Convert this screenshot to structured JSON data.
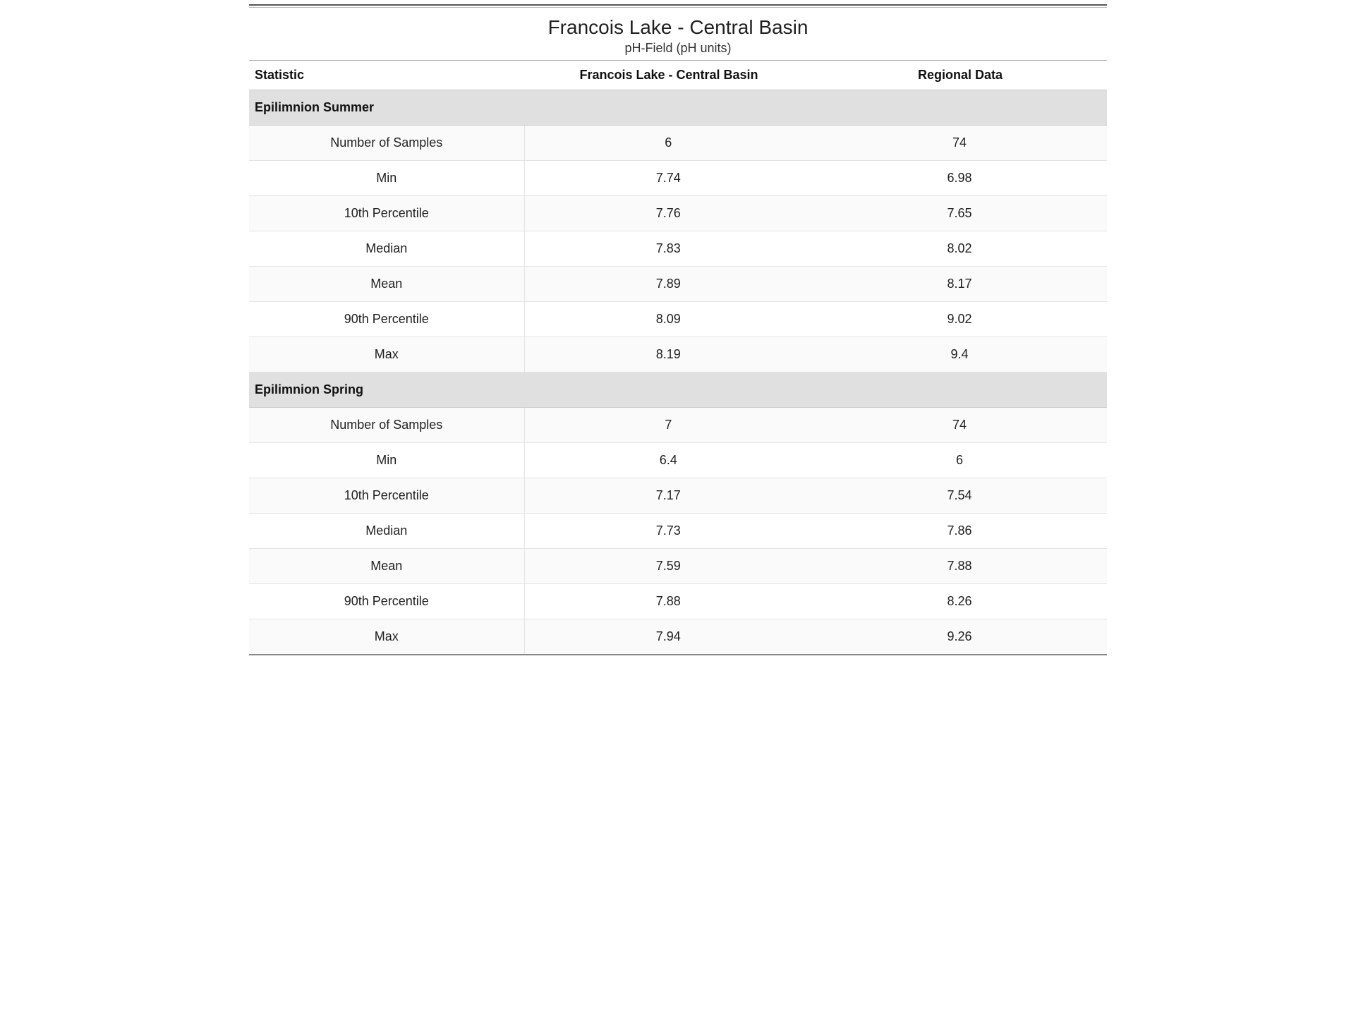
{
  "header": {
    "title": "Francois Lake - Central Basin",
    "subtitle": "pH-Field (pH units)"
  },
  "columns": {
    "stat": "Statistic",
    "site": "Francois Lake - Central Basin",
    "regional": "Regional Data"
  },
  "sections": [
    {
      "name": "Epilimnion Summer",
      "rows": [
        {
          "stat": "Number of Samples",
          "site": "6",
          "regional": "74"
        },
        {
          "stat": "Min",
          "site": "7.74",
          "regional": "6.98"
        },
        {
          "stat": "10th Percentile",
          "site": "7.76",
          "regional": "7.65"
        },
        {
          "stat": "Median",
          "site": "7.83",
          "regional": "8.02"
        },
        {
          "stat": "Mean",
          "site": "7.89",
          "regional": "8.17"
        },
        {
          "stat": "90th Percentile",
          "site": "8.09",
          "regional": "9.02"
        },
        {
          "stat": "Max",
          "site": "8.19",
          "regional": "9.4"
        }
      ]
    },
    {
      "name": "Epilimnion Spring",
      "rows": [
        {
          "stat": "Number of Samples",
          "site": "7",
          "regional": "74"
        },
        {
          "stat": "Min",
          "site": "6.4",
          "regional": "6"
        },
        {
          "stat": "10th Percentile",
          "site": "7.17",
          "regional": "7.54"
        },
        {
          "stat": "Median",
          "site": "7.73",
          "regional": "7.86"
        },
        {
          "stat": "Mean",
          "site": "7.59",
          "regional": "7.88"
        },
        {
          "stat": "90th Percentile",
          "site": "7.88",
          "regional": "8.26"
        },
        {
          "stat": "Max",
          "site": "7.94",
          "regional": "9.26"
        }
      ]
    }
  ]
}
